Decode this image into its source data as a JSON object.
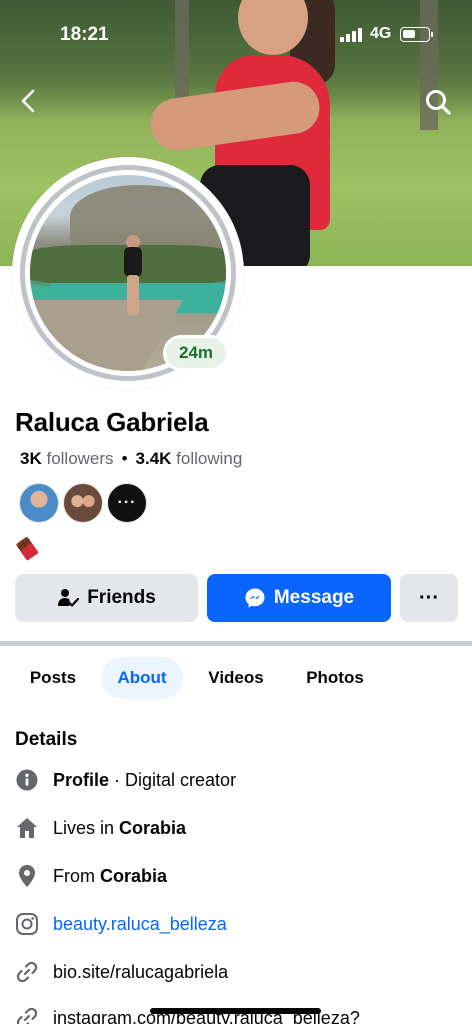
{
  "status_bar": {
    "time": "18:21",
    "network": "4G"
  },
  "cover": {
    "description_icon": "cover-photo"
  },
  "avatar": {
    "story_badge": "24m"
  },
  "profile": {
    "name": "Raluca Gabriela",
    "followers_count": "3K",
    "followers_label": "followers",
    "separator": "•",
    "following_count": "3.4K",
    "following_label": "following",
    "mutual_more": "···",
    "emoji_icon": "chocolate-bar-icon"
  },
  "actions": {
    "friends_label": "Friends",
    "message_label": "Message",
    "more_label": "···"
  },
  "tabs": [
    {
      "label": "Posts",
      "selected": false
    },
    {
      "label": "About",
      "selected": true
    },
    {
      "label": "Videos",
      "selected": false
    },
    {
      "label": "Photos",
      "selected": false
    }
  ],
  "details": {
    "title": "Details",
    "profile_label": "Profile",
    "profile_sep": " · ",
    "profile_value": "Digital creator",
    "lives_prefix": "Lives in ",
    "lives_value": "Corabia",
    "from_prefix": "From ",
    "from_value": "Corabia",
    "instagram": "beauty.raluca_belleza",
    "website": "bio.site/ralucagabriela",
    "link2": "instagram.com/beauty.raluca_belleza?"
  },
  "colors": {
    "accent": "#0866ff",
    "button_gray": "#e4e6eb",
    "tab_selected_bg": "#ebf5ff",
    "badge_green": "#1e6e2f"
  }
}
